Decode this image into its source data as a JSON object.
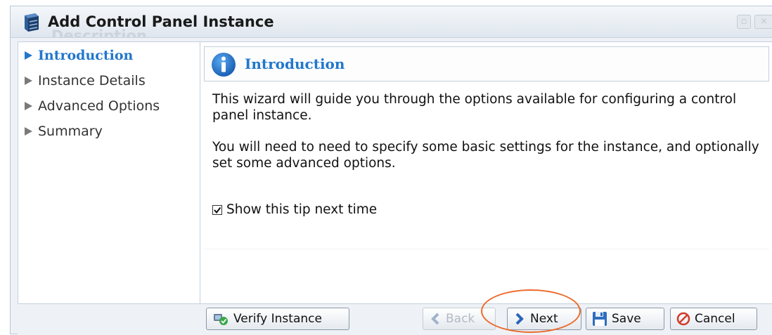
{
  "window": {
    "title": "Add Control Panel Instance",
    "ghost_text": "Description",
    "icon": "server-stack-icon",
    "controls": [
      "maximize-icon",
      "close-icon"
    ]
  },
  "sidebar": {
    "items": [
      {
        "label": "Introduction",
        "active": true,
        "icon": "triangle-right-icon"
      },
      {
        "label": "Instance Details",
        "active": false,
        "icon": "triangle-right-icon"
      },
      {
        "label": "Advanced Options",
        "active": false,
        "icon": "triangle-right-icon"
      },
      {
        "label": "Summary",
        "active": false,
        "icon": "triangle-right-icon"
      }
    ]
  },
  "main": {
    "heading": "Introduction",
    "heading_icon": "info-icon",
    "paragraph1": "This wizard will guide you through the options available for configuring a control panel instance.",
    "paragraph2": "You will need to need to specify some basic settings for the instance, and optionally set some advanced options.",
    "tip_checkbox": {
      "label": "Show this tip next time",
      "checked": true
    }
  },
  "footer": {
    "verify_label": "Verify Instance",
    "back_label": "Back",
    "back_enabled": false,
    "next_label": "Next",
    "save_label": "Save",
    "cancel_label": "Cancel"
  },
  "colors": {
    "accent": "#2277cc",
    "highlight": "#ec6a2b",
    "border": "#c5cfdb",
    "footer_bg": "#eef2f7"
  }
}
